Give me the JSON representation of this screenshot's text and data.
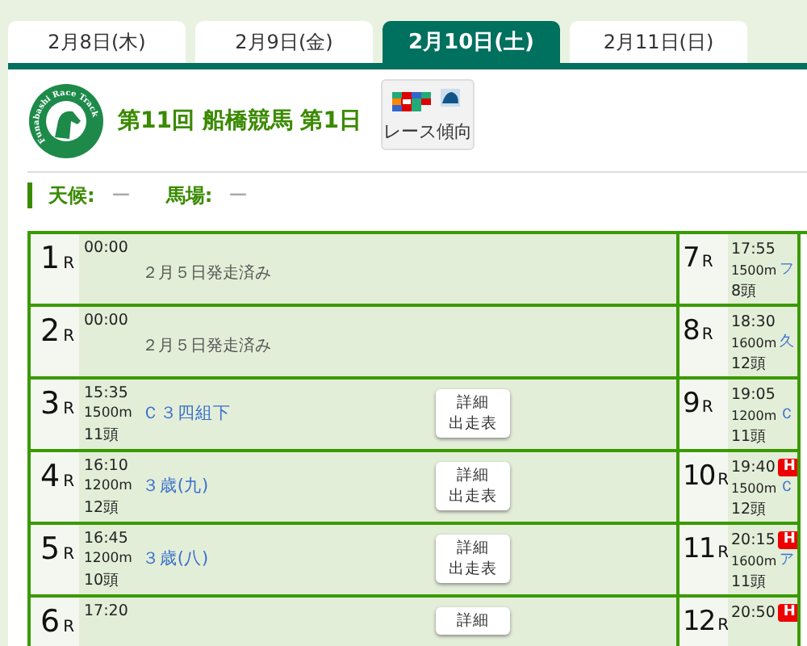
{
  "tabs": [
    {
      "label": "2月8日(木)",
      "selected": false
    },
    {
      "label": "2月9日(金)",
      "selected": false
    },
    {
      "label": "2月10日(土)",
      "selected": true
    },
    {
      "label": "2月11日(日)",
      "selected": false
    }
  ],
  "meet": {
    "logo_text": "Funabashi Race Track",
    "title": "第11回 船橋競馬 第1日",
    "trend_button": "レース傾向"
  },
  "conditions": [
    {
      "label": "天候:",
      "value": "ー"
    },
    {
      "label": "馬場:",
      "value": "ー"
    }
  ],
  "races_left": [
    {
      "number": "1",
      "unit": "R",
      "time": "00:00",
      "note": "２月５日発走済み"
    },
    {
      "number": "2",
      "unit": "R",
      "time": "00:00",
      "note": "２月５日発走済み"
    },
    {
      "number": "3",
      "unit": "R",
      "time": "15:35",
      "distance": "1500m",
      "heads": "11頭",
      "name": "Ｃ３四組下",
      "button": [
        "詳細",
        "出走表"
      ]
    },
    {
      "number": "4",
      "unit": "R",
      "time": "16:10",
      "distance": "1200m",
      "heads": "12頭",
      "name": "３歳(九)",
      "button": [
        "詳細",
        "出走表"
      ]
    },
    {
      "number": "5",
      "unit": "R",
      "time": "16:45",
      "distance": "1200m",
      "heads": "10頭",
      "name": "３歳(八)",
      "button": [
        "詳細",
        "出走表"
      ]
    },
    {
      "number": "6",
      "unit": "R",
      "time": "17:20",
      "button": [
        "詳細"
      ]
    }
  ],
  "races_right": [
    {
      "number": "7",
      "unit": "R",
      "time": "17:55",
      "distance": "1500m",
      "heads": "8頭",
      "name": "フ"
    },
    {
      "number": "8",
      "unit": "R",
      "time": "18:30",
      "distance": "1600m",
      "heads": "12頭",
      "name": "久"
    },
    {
      "number": "9",
      "unit": "R",
      "time": "19:05",
      "distance": "1200m",
      "heads": "11頭",
      "name": "Ｃ"
    },
    {
      "number": "10",
      "unit": "R",
      "time": "19:40",
      "distance": "1500m",
      "heads": "12頭",
      "name": "Ｃ",
      "badge": "H"
    },
    {
      "number": "11",
      "unit": "R",
      "time": "20:15",
      "distance": "1600m",
      "heads": "11頭",
      "name": "ア",
      "badge": "H"
    },
    {
      "number": "12",
      "unit": "R",
      "time": "20:50",
      "badge": "H"
    }
  ]
}
